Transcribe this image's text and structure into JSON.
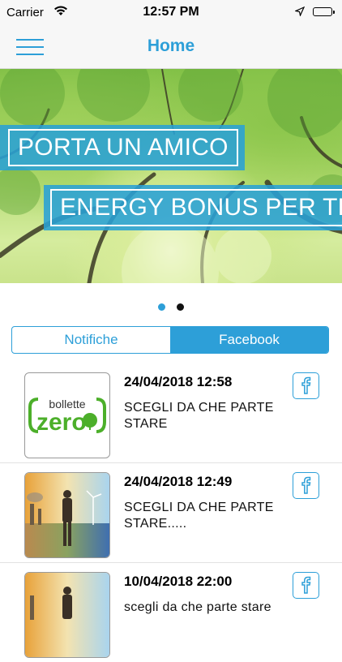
{
  "status_bar": {
    "carrier": "Carrier",
    "time": "12:57 PM"
  },
  "nav": {
    "title": "Home",
    "menu_icon": "hamburger-menu-icon"
  },
  "banner": {
    "line1": "PORTA UN AMICO",
    "line2": "ENERGY BONUS PER TE",
    "accent": "#29a0d6"
  },
  "pager": {
    "count": 2,
    "active_index": 0,
    "active_color": "#2d9fd8",
    "inactive_color": "#111111"
  },
  "tabs": [
    {
      "label": "Notifiche",
      "active": false
    },
    {
      "label": "Facebook",
      "active": true
    }
  ],
  "posts": [
    {
      "date": "24/04/2018 12:58",
      "text": "SCEGLI  DA CHE PARTE STARE",
      "thumb_brand_top": "bollette",
      "thumb_brand_bottom": "zero",
      "thumb": "bollette-zero-logo"
    },
    {
      "date": "24/04/2018 12:49",
      "text": "SCEGLI  DA CHE PARTE STARE.....",
      "thumb": "man-between-pollution-and-solar-image"
    },
    {
      "date": "10/04/2018 22:00",
      "text": "scegli da che parte stare",
      "thumb": "man-between-pollution-and-solar-image"
    }
  ],
  "colors": {
    "brand_blue": "#2d9fd8",
    "brand_green": "#4caf2a"
  }
}
